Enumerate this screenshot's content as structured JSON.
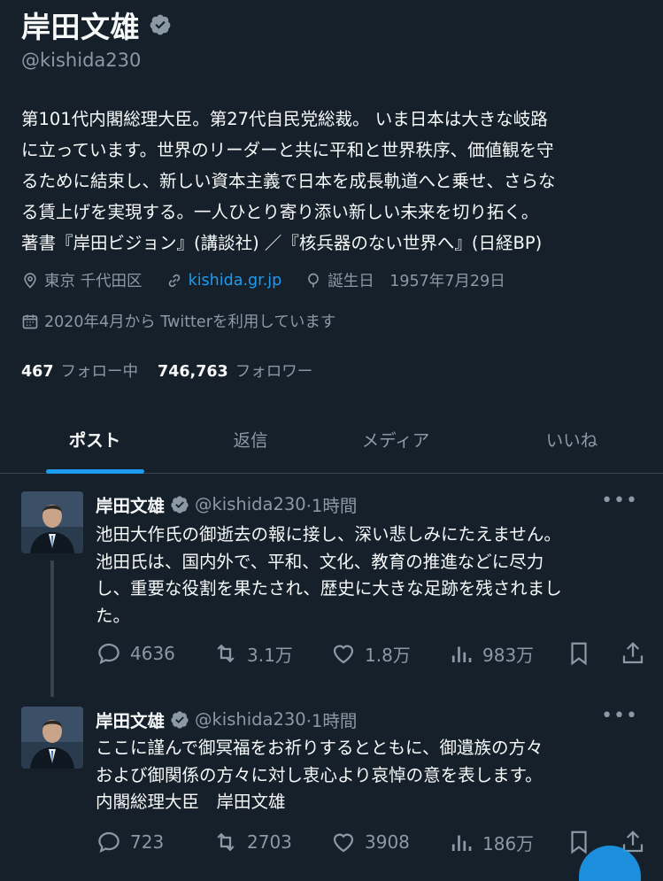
{
  "profile": {
    "name": "岸田文雄",
    "handle": "@kishida230",
    "bio_lines": [
      "第101代内閣総理大臣。第27代自民党総裁。 いま日本は大きな岐路",
      "に立っています。世界のリーダーと共に平和と世界秩序、価値観を守",
      "るために結束し、新しい資本主義で日本を成長軌道へと乗せ、さらな",
      "る賃上げを実現する。一人ひとり寄り添い新しい未来を切り拓く。",
      "著書『岸田ビジョン』(講談社) ／『核兵器のない世界へ』(日経BP)"
    ],
    "location": "東京 千代田区",
    "website": "kishida.gr.jp",
    "birthday": "誕生日　1957年7月29日",
    "joined": "2020年4月から Twitterを利用しています",
    "following_count": "467",
    "following_label": "フォロー中",
    "followers_count": "746,763",
    "followers_label": "フォロワー"
  },
  "tabs": [
    {
      "label": "ポスト",
      "active": true
    },
    {
      "label": "返信",
      "active": false
    },
    {
      "label": "メディア",
      "active": false
    },
    {
      "label": "いいね",
      "active": false
    }
  ],
  "tweets": [
    {
      "name": "岸田文雄",
      "handle": "@kishida230",
      "time": "·1時間",
      "text_lines": [
        "池田大作氏の御逝去の報に接し、深い悲しみにたえません。",
        "池田氏は、国内外で、平和、文化、教育の推進などに尽力",
        "し、重要な役割を果たされ、歴史に大きな足跡を残されまし",
        "た。"
      ],
      "replies": "4636",
      "retweets": "3.1万",
      "likes": "1.8万",
      "views": "983万"
    },
    {
      "name": "岸田文雄",
      "handle": "@kishida230",
      "time": "·1時間",
      "text_lines": [
        "ここに謹んで御冥福をお祈りするとともに、御遺族の方々",
        "および御関係の方々に対し衷心より哀悼の意を表します。",
        "内閣総理大臣　岸田文雄"
      ],
      "replies": "723",
      "retweets": "2703",
      "likes": "3908",
      "views": "186万"
    }
  ],
  "colors": {
    "background": "#15202b",
    "accent": "#1d9bf0",
    "muted": "#8b98a5",
    "text": "#f7f9f9"
  },
  "icons": [
    "verified-badge-icon",
    "location-icon",
    "link-icon",
    "birthday-icon",
    "calendar-icon",
    "reply-icon",
    "retweet-icon",
    "like-icon",
    "views-icon",
    "bookmark-icon",
    "share-icon",
    "more-icon"
  ]
}
